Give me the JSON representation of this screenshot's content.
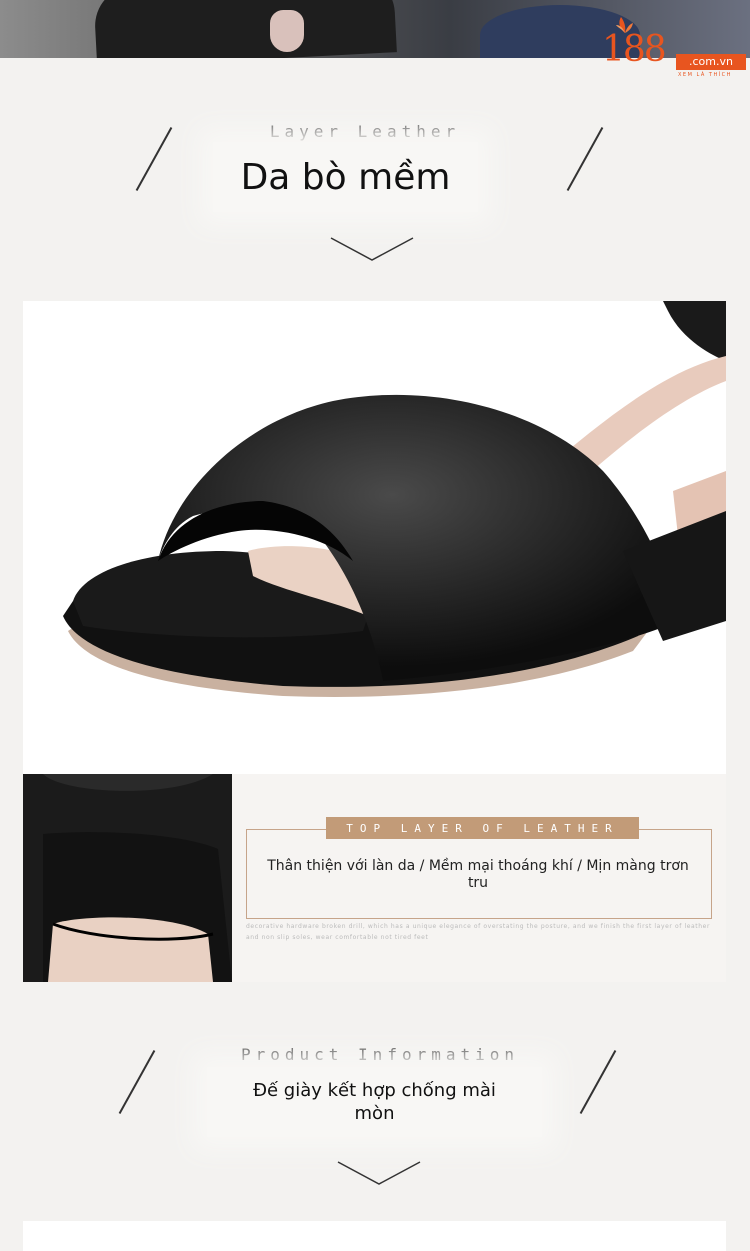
{
  "logo": {
    "number": "188",
    "domain": ".com.vn",
    "tagline": "XEM LÀ THÍCH",
    "brand_color": "#e8551f"
  },
  "section_1": {
    "heading_en": "Layer Leather",
    "heading_vi": "Da bò mềm"
  },
  "leather_info": {
    "label": "TOP LAYER OF LEATHER",
    "description": "Thân thiện với làn da / Mềm mại thoáng khí / Mịn màng trơn tru",
    "fine_print": "decorative hardware broken drill, which has a unique elegance of overstating the posture, and we finish the first layer of leather and non slip soles, wear comfortable not tired feet",
    "accent_color": "#c29b78"
  },
  "section_2": {
    "heading_en": "Product Information",
    "heading_vi": "Đế giày kết hợp chống mài mòn"
  }
}
